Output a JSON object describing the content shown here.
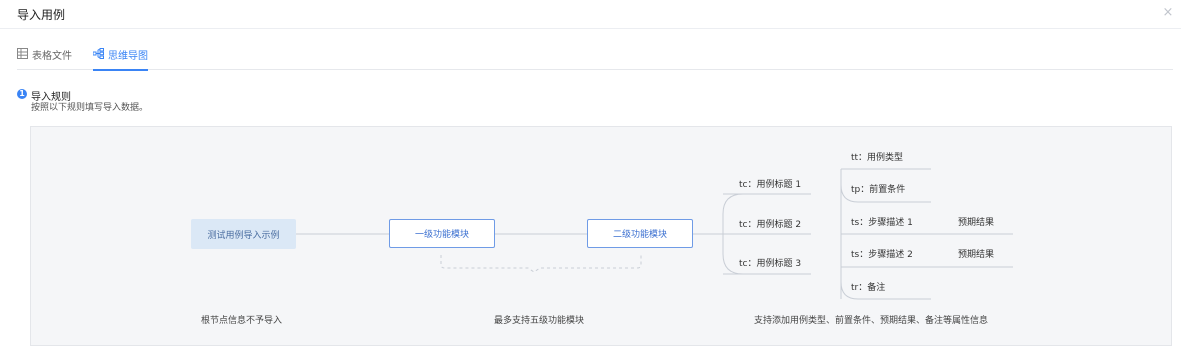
{
  "dialog": {
    "title": "导入用例",
    "close_icon": "×"
  },
  "tabs": [
    {
      "label": "表格文件",
      "icon": "table-icon",
      "active": false
    },
    {
      "label": "思维导图",
      "icon": "mindmap-icon",
      "active": true
    }
  ],
  "rule": {
    "number": "1",
    "title": "导入规则",
    "description": "按照以下规则填写导入数据。"
  },
  "mindmap": {
    "root": "测试用例导入示例",
    "level1": "一级功能模块",
    "level2": "二级功能模块",
    "cases": [
      "tc：用例标题 1",
      "tc：用例标题 2",
      "tc：用例标题 3"
    ],
    "attributes": [
      "tt：用例类型",
      "tp：前置条件",
      "ts：步骤描述 1",
      "ts：步骤描述 2",
      "tr：备注"
    ],
    "results": [
      "预期结果",
      "预期结果"
    ],
    "captions": [
      "根节点信息不予导入",
      "最多支持五级功能模块",
      "支持添加用例类型、前置条件、预期结果、备注等属性信息"
    ]
  },
  "colors": {
    "accent": "#3a84f5",
    "node_border": "#6f9be6",
    "root_fill": "#dbe8f6",
    "canvas_bg": "#f5f6f8"
  }
}
